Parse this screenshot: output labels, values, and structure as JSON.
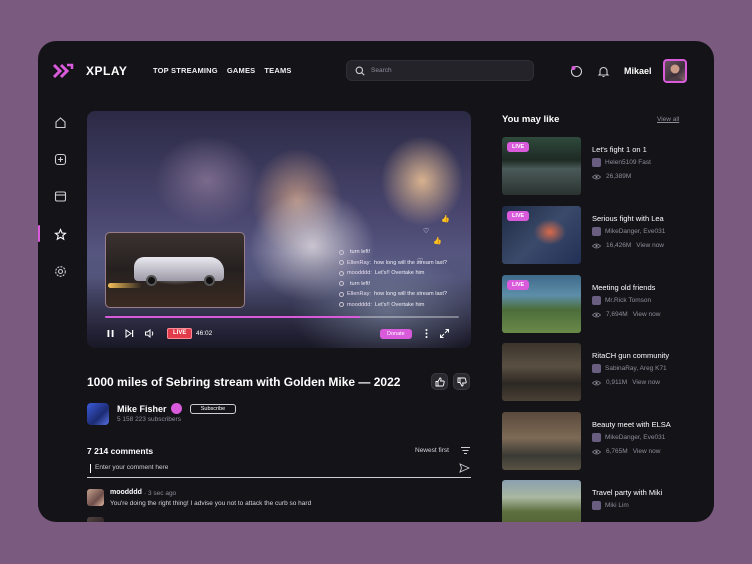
{
  "app": {
    "name": "XPLAY"
  },
  "nav": [
    "TOP STREAMING",
    "GAMES",
    "TEAMS"
  ],
  "search": {
    "placeholder": "Search"
  },
  "user": {
    "name": "Mikael"
  },
  "colors": {
    "accent": "#d95bdc",
    "live": "#e23b4a",
    "background": "#141318",
    "frame": "#7a5a7e"
  },
  "sidebar_icons": [
    "home-icon",
    "add-square-icon",
    "browser-icon",
    "star-icon",
    "settings-icon"
  ],
  "player": {
    "live_label": "LIVE",
    "time": "46:02",
    "donate_label": "Donate",
    "progress_fraction": 0.72,
    "chat": [
      {
        "user": "",
        "text": "turn left!"
      },
      {
        "user": "EllenRay:",
        "text": "how long will the stream last?"
      },
      {
        "user": "moodddd:",
        "text": "Let's!! Overtake him"
      },
      {
        "user": "",
        "text": "turn left!"
      },
      {
        "user": "EllenRay:",
        "text": "how long will the stream last?"
      },
      {
        "user": "moodddd:",
        "text": "Let's!! Overtake him"
      }
    ]
  },
  "video": {
    "title": "1000 miles of Sebring stream with Golden Mike — 2022",
    "channel": "Mike Fisher",
    "subscribers": "5 158 223 subscribers",
    "subscribe_label": "Subscribe"
  },
  "comments": {
    "count": "7 214 comments",
    "sort": "Newest first",
    "placeholder": "Enter your comment here",
    "items": [
      {
        "user": "moodddd",
        "time": "3 sec ago",
        "text": "You're doing the right thing! I advise you not to attack the curb so hard"
      }
    ]
  },
  "recommendations": {
    "title": "You may like",
    "view_all": "View all",
    "items": [
      {
        "title": "Let's fight 1 on 1",
        "author": "Helen5109 Fast",
        "views": "26,389M",
        "live": true
      },
      {
        "title": "Serious fight with Lea",
        "author": "MikeDanger, Eve031",
        "views": "16,426M",
        "live": true,
        "view_now": "View now"
      },
      {
        "title": "Meeting old friends",
        "author": "Mr.Rick Tomson",
        "views": "7,694M",
        "live": true,
        "view_now": "View now"
      },
      {
        "title": "RitaCH gun community",
        "author": "SabinaRay, Areg K71",
        "views": "0,911M",
        "live": false,
        "view_now": "View now"
      },
      {
        "title": "Beauty meet with ELSA",
        "author": "MikeDanger, Eve031",
        "views": "6,765M",
        "live": false,
        "view_now": "View now"
      },
      {
        "title": "Travel party with Miki",
        "author": "Miki Lim",
        "views": "",
        "live": false
      }
    ],
    "live_label": "LIVE"
  }
}
